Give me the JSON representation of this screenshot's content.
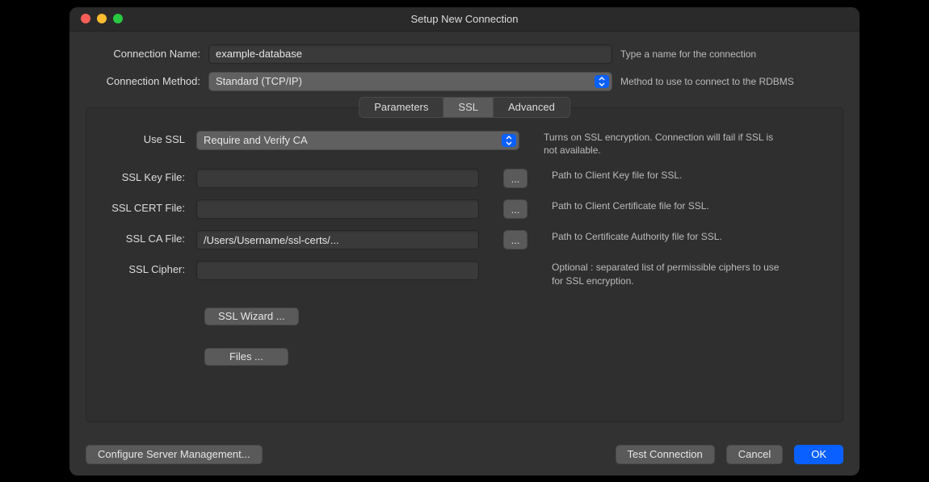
{
  "window": {
    "title": "Setup New Connection"
  },
  "top": {
    "connection_name_label": "Connection Name:",
    "connection_name_value": "example-database",
    "connection_name_hint": "Type a name for the connection",
    "connection_method_label": "Connection Method:",
    "connection_method_value": "Standard (TCP/IP)",
    "connection_method_hint": "Method to use to connect to the RDBMS"
  },
  "tabs": {
    "parameters": "Parameters",
    "ssl": "SSL",
    "advanced": "Advanced"
  },
  "ssl_panel": {
    "use_ssl_label": "Use SSL",
    "use_ssl_value": "Require and Verify CA",
    "use_ssl_hint": "Turns on SSL encryption. Connection will fail if SSL is not available.",
    "key_file_label": "SSL Key File:",
    "key_file_value": "",
    "key_file_hint": "Path to Client Key file for SSL.",
    "cert_file_label": "SSL CERT File:",
    "cert_file_value": "",
    "cert_file_hint": "Path to Client Certificate file for SSL.",
    "ca_file_label": "SSL CA File:",
    "ca_file_value": "/Users/Username/ssl-certs/...",
    "ca_file_hint": "Path to Certificate Authority file for SSL.",
    "cipher_label": "SSL Cipher:",
    "cipher_value": "",
    "cipher_hint": "Optional : separated list of permissible ciphers to use for SSL encryption.",
    "wizard_button": "SSL Wizard ...",
    "files_button": "Files ...",
    "browse": "..."
  },
  "footer": {
    "configure": "Configure Server Management...",
    "test": "Test Connection",
    "cancel": "Cancel",
    "ok": "OK"
  }
}
